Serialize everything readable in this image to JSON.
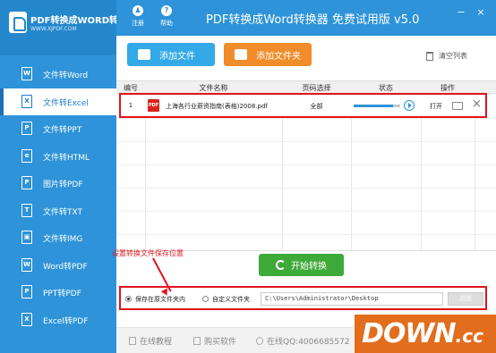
{
  "app": {
    "logo_title": "PDF转换成WORD转换器",
    "logo_url": "WWW.XJPDF.COM",
    "title": "PDF转换成Word转换器 免费试用版 v5.0",
    "register_label": "注册",
    "help_label": "帮助",
    "minimize": "−",
    "close": "×"
  },
  "sidebar": {
    "items": [
      {
        "label": "文件转Word",
        "icon": "W"
      },
      {
        "label": "文件转Excel",
        "icon": "X"
      },
      {
        "label": "文件转PPT",
        "icon": "P"
      },
      {
        "label": "文件转HTML",
        "icon": "e"
      },
      {
        "label": "图片转PDF",
        "icon": "P"
      },
      {
        "label": "文件转TXT",
        "icon": "T"
      },
      {
        "label": "文件转IMG",
        "icon": "▣"
      },
      {
        "label": "Word转PDF",
        "icon": "W"
      },
      {
        "label": "PPT转PDF",
        "icon": "P"
      },
      {
        "label": "Excel转PDF",
        "icon": "X"
      }
    ],
    "active_index": 1
  },
  "toolbar": {
    "add_file_label": "添加文件",
    "add_folder_label": "添加文件夹",
    "clear_list_label": "清空列表",
    "add_file_color": "#33a9e8",
    "add_folder_color": "#f08c2a"
  },
  "table": {
    "headers": {
      "index": "编号",
      "name": "文件名称",
      "pages": "页码选择",
      "status": "状态",
      "actions": "操作"
    },
    "rows": [
      {
        "index": "1",
        "file_icon": "PDF",
        "name": "上海各行业薪资指南(表格)2008.pdf",
        "pages": "全部",
        "progress": 0.85,
        "open_label": "打开"
      }
    ]
  },
  "convert": {
    "start_label": "开始转换",
    "annotation": "设置转换文件保存位置",
    "save_original_label": "保存在原文件夹内",
    "custom_folder_label": "自定义文件夹",
    "path_value": "C:\\Users\\Administrator\\Desktop",
    "browse_label": "浏览",
    "save_original_checked": true
  },
  "statusbar": {
    "tutorial_label": "在线教程",
    "buy_label": "购买软件",
    "qq_label": "在线QQ:4006685572"
  },
  "watermark": {
    "main": "DOWN",
    "suffix": ".cc"
  }
}
